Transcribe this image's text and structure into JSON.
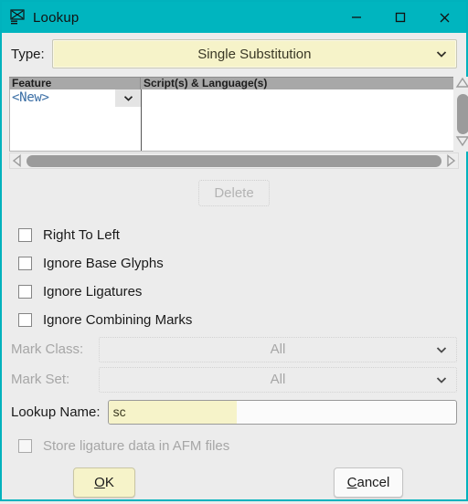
{
  "window": {
    "title": "Lookup",
    "icon": "fontforge-glyph-icon",
    "accent_color": "#00b5bf",
    "background_color": "#ececec",
    "controls": [
      {
        "name": "minimize",
        "glyph": "minimize-icon"
      },
      {
        "name": "maximize",
        "glyph": "maximize-icon"
      },
      {
        "name": "close",
        "glyph": "close-icon"
      }
    ]
  },
  "type_row": {
    "label": "Type:",
    "value": "Single Substitution",
    "options": [
      "Single Substitution"
    ]
  },
  "feature_list": {
    "columns": [
      "Feature",
      "Script(s) & Language(s)"
    ],
    "rows": [
      {
        "feature": "<New>",
        "scripts": ""
      }
    ]
  },
  "delete_button": {
    "label": "Delete",
    "enabled": false
  },
  "flags": [
    {
      "label": "Right To Left",
      "checked": false,
      "enabled": true
    },
    {
      "label": "Ignore Base Glyphs",
      "checked": false,
      "enabled": true
    },
    {
      "label": "Ignore Ligatures",
      "checked": false,
      "enabled": true
    },
    {
      "label": "Ignore Combining Marks",
      "checked": false,
      "enabled": true
    }
  ],
  "mark_class": {
    "label": "Mark Class:",
    "value": "All",
    "enabled": false
  },
  "mark_set": {
    "label": "Mark Set:",
    "value": "All",
    "enabled": false
  },
  "lookup_name": {
    "label": "Lookup Name:",
    "value": "sc",
    "selected_text": "sc"
  },
  "afm": {
    "label": "Store ligature data in AFM files",
    "checked": false,
    "enabled": false
  },
  "buttons": {
    "ok": {
      "pre": "",
      "mnemonic": "O",
      "post": "K"
    },
    "cancel": {
      "pre": "",
      "mnemonic": "C",
      "post": "ancel"
    }
  }
}
